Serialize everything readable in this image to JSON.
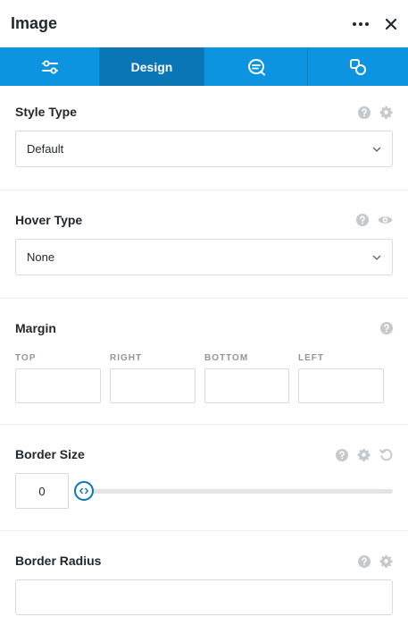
{
  "header": {
    "title": "Image",
    "more_icon": "more-horizontal-icon",
    "close_icon": "close-icon"
  },
  "tabs": [
    {
      "label": "",
      "icon": "sliders-icon"
    },
    {
      "label": "Design",
      "icon": ""
    },
    {
      "label": "",
      "icon": "search-chat-icon"
    },
    {
      "label": "",
      "icon": "shapes-icon"
    }
  ],
  "style_type": {
    "label": "Style Type",
    "value": "Default",
    "icons": [
      "help-icon",
      "gear-icon"
    ]
  },
  "hover_type": {
    "label": "Hover Type",
    "value": "None",
    "icons": [
      "help-icon",
      "eye-icon"
    ]
  },
  "margin": {
    "label": "Margin",
    "icons": [
      "help-icon"
    ],
    "fields": [
      {
        "label": "TOP",
        "value": ""
      },
      {
        "label": "RIGHT",
        "value": ""
      },
      {
        "label": "BOTTOM",
        "value": ""
      },
      {
        "label": "LEFT",
        "value": ""
      }
    ]
  },
  "border_size": {
    "label": "Border Size",
    "value": "0",
    "slider_fraction": 0,
    "icons": [
      "help-icon",
      "gear-icon",
      "reset-icon"
    ]
  },
  "border_radius": {
    "label": "Border Radius",
    "value": "",
    "icons": [
      "help-icon",
      "gear-icon"
    ]
  },
  "colors": {
    "accent": "#0d94e1",
    "accent_active": "#0a76b5",
    "icon_muted": "#c4c9ce"
  }
}
